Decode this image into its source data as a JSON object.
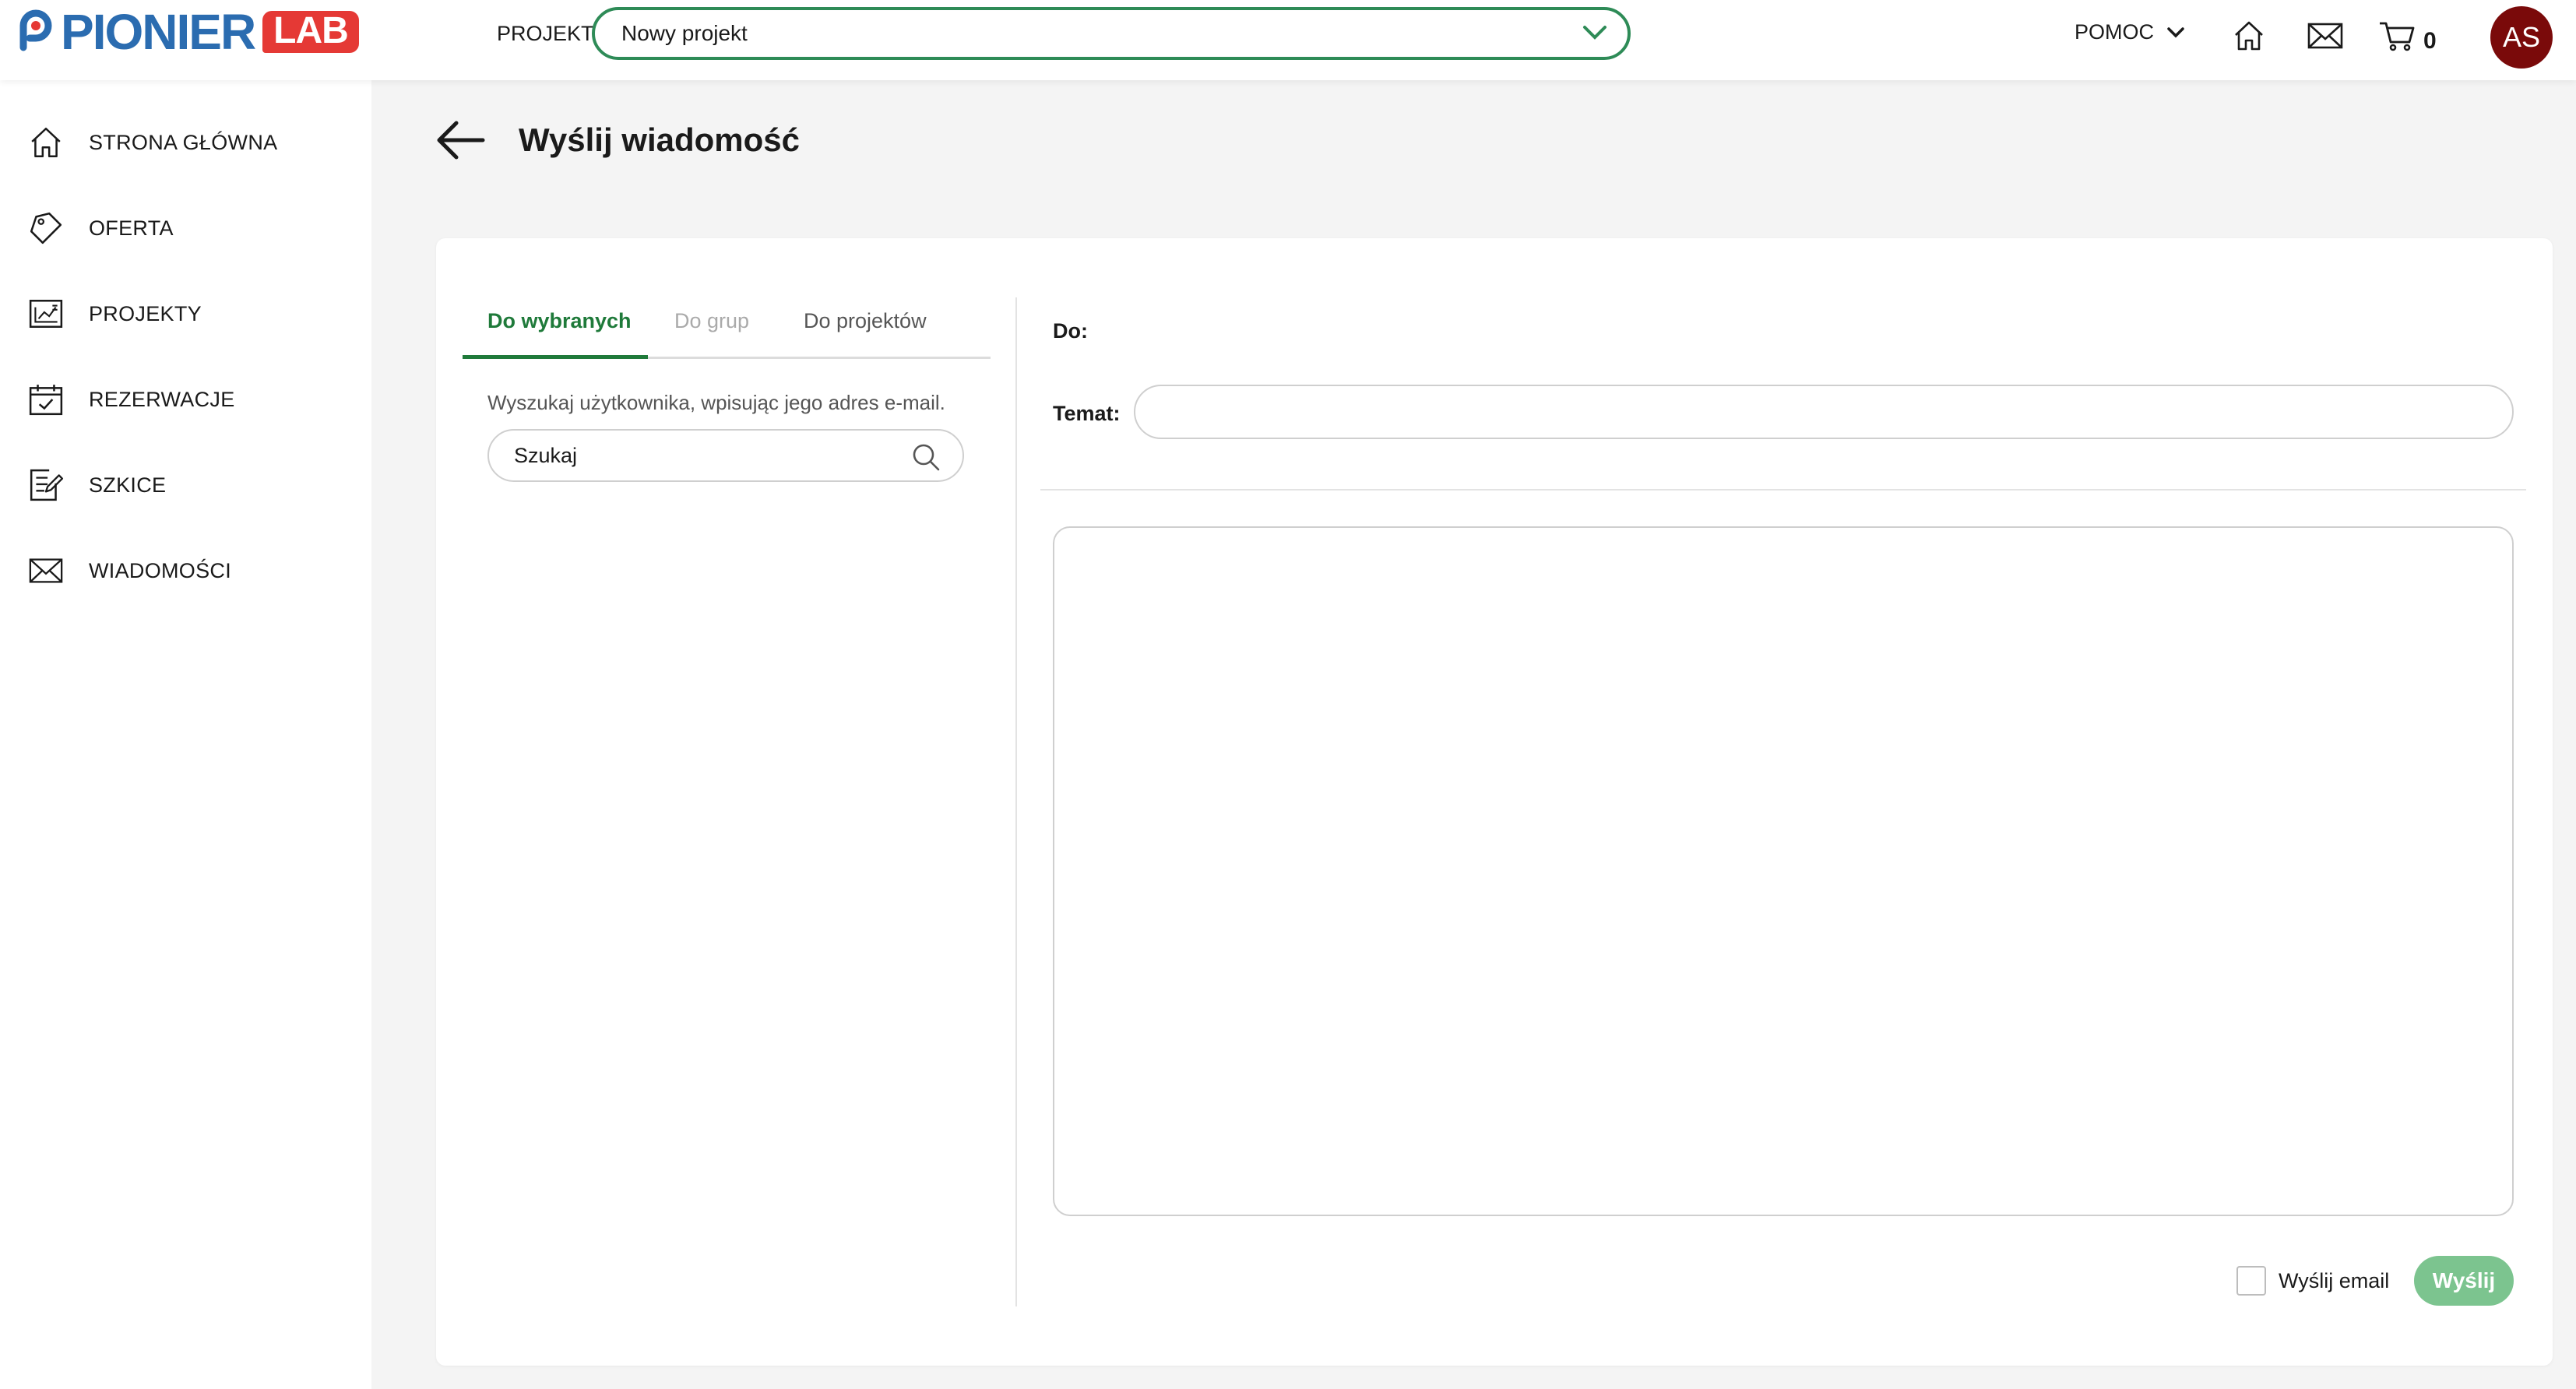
{
  "header": {
    "logo_text": "PIONIER",
    "logo_badge": "LAB",
    "project_label": "PROJEKT",
    "project_selected": "Nowy projekt",
    "help_label": "POMOC",
    "cart_count": "0",
    "avatar_initials": "AS",
    "colors": {
      "accent": "#2e8b57",
      "avatar_bg": "#7a0a0a",
      "logo_blue": "#2b6cb0",
      "logo_red": "#e53935"
    }
  },
  "sidebar": {
    "items": [
      {
        "label": "STRONA GŁÓWNA",
        "icon": "home-icon"
      },
      {
        "label": "OFERTA",
        "icon": "tag-icon"
      },
      {
        "label": "PROJEKTY",
        "icon": "projects-icon"
      },
      {
        "label": "REZERWACJE",
        "icon": "calendar-icon"
      },
      {
        "label": "SZKICE",
        "icon": "drafts-icon"
      },
      {
        "label": "WIADOMOŚCI",
        "icon": "envelope-icon"
      }
    ]
  },
  "page": {
    "title": "Wyślij wiadomość"
  },
  "recipients": {
    "tabs": [
      {
        "label": "Do wybranych",
        "state": "active"
      },
      {
        "label": "Do grup",
        "state": "disabled"
      },
      {
        "label": "Do projektów",
        "state": "normal"
      }
    ],
    "hint": "Wyszukaj użytkownika, wpisując jego adres e-mail.",
    "search_placeholder": "Szukaj"
  },
  "form": {
    "to_label": "Do:",
    "subject_label": "Temat:",
    "subject_value": "",
    "message_value": "",
    "send_email_label": "Wyślij email",
    "send_email_checked": false,
    "send_button": "Wyślij",
    "send_button_color": "#7cc48f"
  }
}
